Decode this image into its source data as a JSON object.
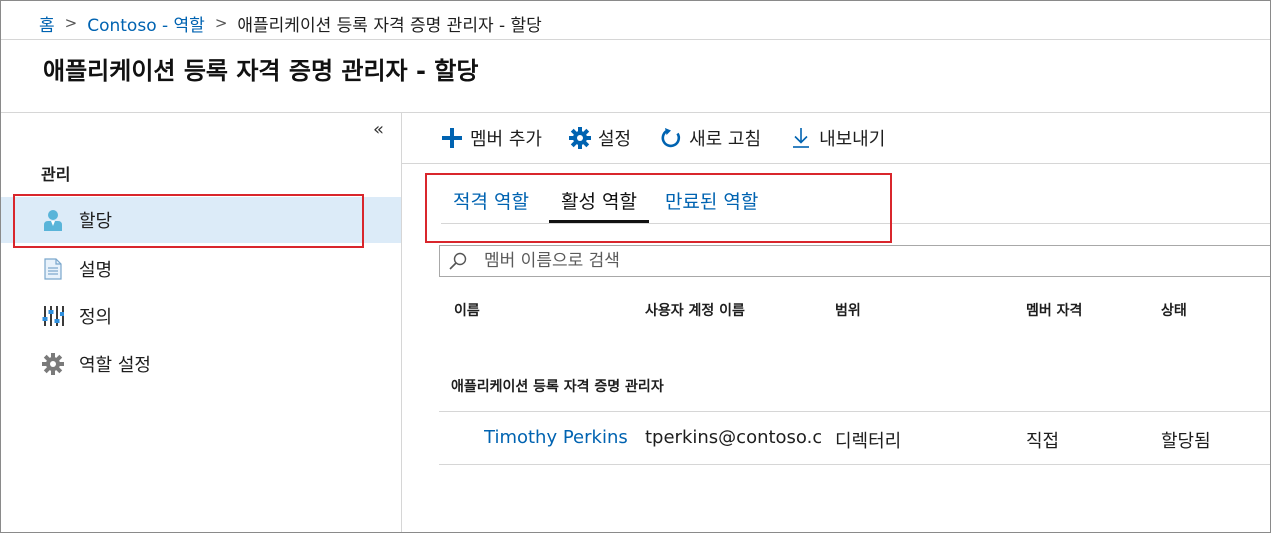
{
  "breadcrumb": {
    "home": "홈",
    "parent": "Contoso - 역할",
    "current": "애플리케이션 등록 자격 증명 관리자 - 할당"
  },
  "page_title": "애플리케이션 등록 자격 증명 관리자 - 할당",
  "sidebar": {
    "collapse_glyph": "«",
    "section_label": "관리",
    "items": [
      {
        "label": "할당",
        "icon": "user-icon",
        "selected": true
      },
      {
        "label": "설명",
        "icon": "document-icon"
      },
      {
        "label": "정의",
        "icon": "settings-sliders-icon"
      },
      {
        "label": "역할 설정",
        "icon": "gear-icon"
      }
    ]
  },
  "toolbar": {
    "add_member": "멤버 추가",
    "settings": "설정",
    "refresh": "새로 고침",
    "export": "내보내기"
  },
  "tabs": [
    {
      "label": "적격 역할",
      "active": false
    },
    {
      "label": "활성 역할",
      "active": true
    },
    {
      "label": "만료된 역할",
      "active": false
    }
  ],
  "search": {
    "placeholder": "멤버 이름으로 검색",
    "value": ""
  },
  "table": {
    "columns": [
      "이름",
      "사용자 계정 이름",
      "범위",
      "멤버 자격",
      "상태"
    ],
    "group_label": "애플리케이션 등록 자격 증명 관리자",
    "rows": [
      {
        "name": "Timothy Perkins",
        "upn": "tperkins@contoso.com",
        "scope": "디렉터리",
        "membership": "직접",
        "status": "할당됨"
      }
    ]
  },
  "colors": {
    "accent": "#0063b1",
    "selected_bg": "#dcebf8",
    "highlight_red": "#d9262c"
  }
}
